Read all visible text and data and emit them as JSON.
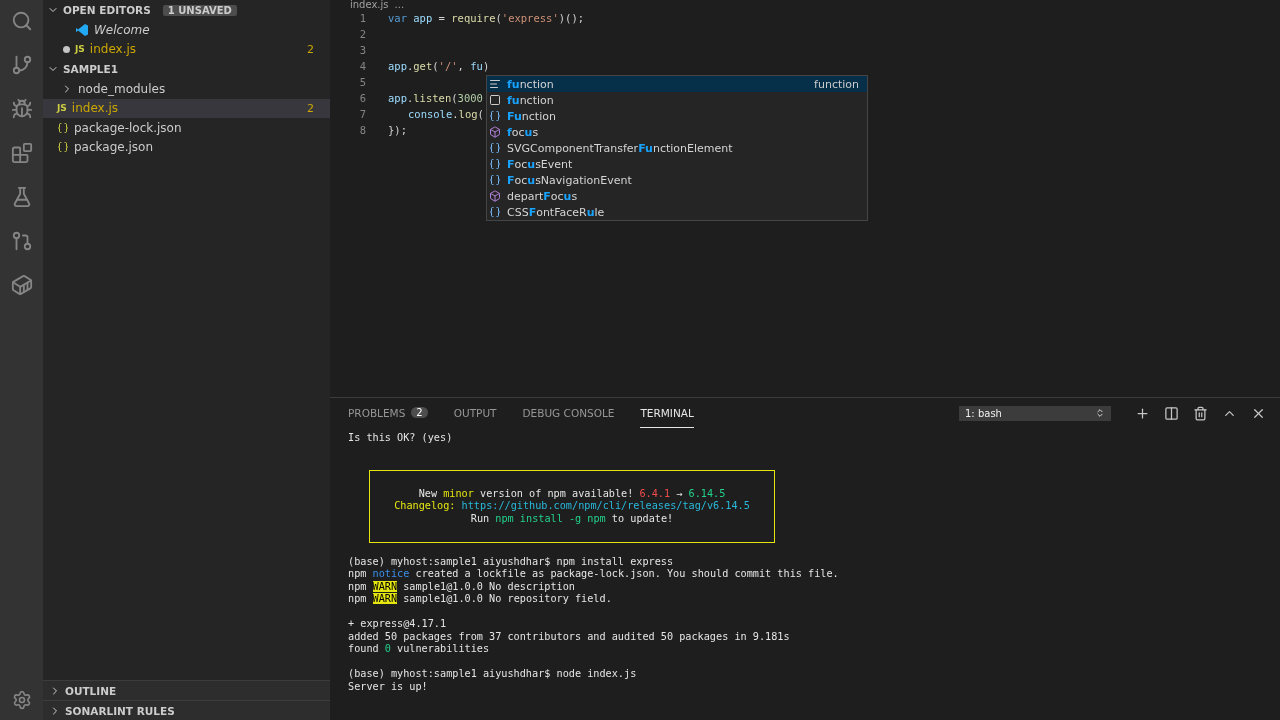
{
  "sidebar": {
    "open_editors": {
      "title": "OPEN EDITORS",
      "badge": "1 UNSAVED",
      "items": [
        {
          "name": "Welcome",
          "kind": "welcome",
          "unsaved": false
        },
        {
          "name": "index.js",
          "kind": "js",
          "icon_label": "JS",
          "unsaved": true,
          "problems": "2"
        }
      ]
    },
    "folder": {
      "title": "SAMPLE1",
      "expanded": true,
      "items": [
        {
          "name": "node_modules",
          "kind": "folder",
          "expanded": false,
          "selected": false
        },
        {
          "name": "index.js",
          "kind": "js",
          "icon_label": "JS",
          "selected": true,
          "problems": "2"
        },
        {
          "name": "package-lock.json",
          "kind": "json",
          "selected": false
        },
        {
          "name": "package.json",
          "kind": "json",
          "selected": false
        }
      ]
    },
    "sections": [
      {
        "title": "OUTLINE",
        "expanded": false
      },
      {
        "title": "SONARLINT RULES",
        "expanded": false
      }
    ]
  },
  "editor": {
    "breadcrumb": [
      "index.js",
      "..."
    ],
    "lines": [
      {
        "number": "1",
        "tokens": [
          {
            "text": "var ",
            "kind": "keyword"
          },
          {
            "text": "app",
            "kind": "var"
          },
          {
            "text": " = ",
            "kind": "plain"
          },
          {
            "text": "require",
            "kind": "fn"
          },
          {
            "text": "(",
            "kind": "plain"
          },
          {
            "text": "'express'",
            "kind": "str"
          },
          {
            "text": ")();",
            "kind": "plain"
          }
        ]
      },
      {
        "number": "2"
      },
      {
        "number": "3"
      },
      {
        "number": "4",
        "tokens": [
          {
            "text": "app",
            "kind": "var"
          },
          {
            "text": ".",
            "kind": "plain"
          },
          {
            "text": "get",
            "kind": "fn"
          },
          {
            "text": "(",
            "kind": "plain"
          },
          {
            "text": "'/'",
            "kind": "str"
          },
          {
            "text": ", ",
            "kind": "plain"
          },
          {
            "text": "fu",
            "kind": "var"
          },
          {
            "text": ")",
            "kind": "plain"
          }
        ]
      },
      {
        "number": "5"
      },
      {
        "number": "6",
        "tokens": [
          {
            "text": "app",
            "kind": "var"
          },
          {
            "text": ".",
            "kind": "plain"
          },
          {
            "text": "listen",
            "kind": "fn"
          },
          {
            "text": "(",
            "kind": "plain"
          },
          {
            "text": "3000",
            "kind": "num"
          }
        ]
      },
      {
        "number": "7",
        "indented": true,
        "tokens": [
          {
            "text": "console",
            "kind": "var"
          },
          {
            "text": ".",
            "kind": "plain"
          },
          {
            "text": "log",
            "kind": "fn"
          },
          {
            "text": "(",
            "kind": "plain"
          }
        ]
      },
      {
        "number": "8",
        "tokens": [
          {
            "text": "});",
            "kind": "plain"
          }
        ]
      }
    ],
    "suggestions": [
      {
        "kind": "keyword",
        "selected": true,
        "detail": "function",
        "parts": [
          {
            "text": "fu",
            "match": true
          },
          {
            "text": "nction",
            "match": false
          }
        ]
      },
      {
        "kind": "snippet",
        "selected": false,
        "parts": [
          {
            "text": "fu",
            "match": true
          },
          {
            "text": "nction",
            "match": false
          }
        ]
      },
      {
        "kind": "variable",
        "selected": false,
        "parts": [
          {
            "text": "Fu",
            "match": true
          },
          {
            "text": "nction",
            "match": false
          }
        ]
      },
      {
        "kind": "method",
        "selected": false,
        "parts": [
          {
            "text": "f",
            "match": true
          },
          {
            "text": "oc",
            "match": false
          },
          {
            "text": "u",
            "match": true
          },
          {
            "text": "s",
            "match": false
          }
        ]
      },
      {
        "kind": "variable",
        "selected": false,
        "parts": [
          {
            "text": "SVGComponentTransfer",
            "match": false
          },
          {
            "text": "Fu",
            "match": true
          },
          {
            "text": "nctionElement",
            "match": false
          }
        ]
      },
      {
        "kind": "variable",
        "selected": false,
        "parts": [
          {
            "text": "F",
            "match": true
          },
          {
            "text": "oc",
            "match": false
          },
          {
            "text": "u",
            "match": true
          },
          {
            "text": "sEvent",
            "match": false
          }
        ]
      },
      {
        "kind": "variable",
        "selected": false,
        "parts": [
          {
            "text": "F",
            "match": true
          },
          {
            "text": "oc",
            "match": false
          },
          {
            "text": "u",
            "match": true
          },
          {
            "text": "sNavigationEvent",
            "match": false
          }
        ]
      },
      {
        "kind": "method",
        "selected": false,
        "parts": [
          {
            "text": "depart",
            "match": false
          },
          {
            "text": "F",
            "match": true
          },
          {
            "text": "oc",
            "match": false
          },
          {
            "text": "u",
            "match": true
          },
          {
            "text": "s",
            "match": false
          }
        ]
      },
      {
        "kind": "variable",
        "selected": false,
        "parts": [
          {
            "text": "CSS",
            "match": false
          },
          {
            "text": "F",
            "match": true
          },
          {
            "text": "ontFaceR",
            "match": false
          },
          {
            "text": "u",
            "match": true
          },
          {
            "text": "le",
            "match": false
          }
        ]
      }
    ]
  },
  "panel": {
    "tabs": [
      {
        "label": "PROBLEMS",
        "count": "2",
        "selected": false
      },
      {
        "label": "OUTPUT",
        "selected": false
      },
      {
        "label": "DEBUG CONSOLE",
        "selected": false
      },
      {
        "label": "TERMINAL",
        "selected": true
      }
    ],
    "terminal_select": "1: bash",
    "terminal": [
      {
        "kind": "line",
        "segments": [
          {
            "text": "Is this OK? (yes)",
            "kind": "plain"
          }
        ]
      },
      {
        "kind": "blank"
      },
      {
        "kind": "blank"
      },
      {
        "kind": "box",
        "lines": [
          [
            {
              "text": "New ",
              "kind": "plain"
            },
            {
              "text": "minor",
              "kind": "yellow"
            },
            {
              "text": " version of npm available! ",
              "kind": "plain"
            },
            {
              "text": "6.4.1",
              "kind": "red"
            },
            {
              "text": " → ",
              "kind": "plain"
            },
            {
              "text": "6.14.5",
              "kind": "green"
            }
          ],
          [
            {
              "text": "Changelog: ",
              "kind": "yellow"
            },
            {
              "text": "https://github.com/npm/cli/releases/tag/v6.14.5",
              "kind": "link"
            }
          ],
          [
            {
              "text": "Run ",
              "kind": "plain"
            },
            {
              "text": "npm install -g npm",
              "kind": "green"
            },
            {
              "text": " to update!",
              "kind": "plain"
            }
          ]
        ]
      },
      {
        "kind": "blank"
      },
      {
        "kind": "line",
        "segments": [
          {
            "text": "(base) myhost:sample1 aiyushdhar$ npm install express",
            "kind": "plain"
          }
        ]
      },
      {
        "kind": "line",
        "segments": [
          {
            "text": "npm ",
            "kind": "plain"
          },
          {
            "text": "notice",
            "kind": "notice"
          },
          {
            "text": " created a lockfile as package-lock.json. You should commit this file.",
            "kind": "plain"
          }
        ]
      },
      {
        "kind": "line",
        "segments": [
          {
            "text": "npm ",
            "kind": "plain"
          },
          {
            "text": "WARN",
            "kind": "warn"
          },
          {
            "text": " sample1@1.0.0 No description",
            "kind": "plain"
          }
        ]
      },
      {
        "kind": "line",
        "segments": [
          {
            "text": "npm ",
            "kind": "plain"
          },
          {
            "text": "WARN",
            "kind": "warn"
          },
          {
            "text": " sample1@1.0.0 No repository field.",
            "kind": "plain"
          }
        ]
      },
      {
        "kind": "blank"
      },
      {
        "kind": "line",
        "segments": [
          {
            "text": "+ express@4.17.1",
            "kind": "plain"
          }
        ]
      },
      {
        "kind": "line",
        "segments": [
          {
            "text": "added 50 packages from 37 contributors and audited 50 packages in 9.181s",
            "kind": "plain"
          }
        ]
      },
      {
        "kind": "line",
        "segments": [
          {
            "text": "found ",
            "kind": "plain"
          },
          {
            "text": "0",
            "kind": "green"
          },
          {
            "text": " vulnerabilities",
            "kind": "plain"
          }
        ]
      },
      {
        "kind": "blank"
      },
      {
        "kind": "line",
        "segments": [
          {
            "text": "(base) myhost:sample1 aiyushdhar$ node index.js",
            "kind": "plain"
          }
        ]
      },
      {
        "kind": "line",
        "segments": [
          {
            "text": "Server is up!",
            "kind": "plain"
          }
        ]
      }
    ]
  }
}
